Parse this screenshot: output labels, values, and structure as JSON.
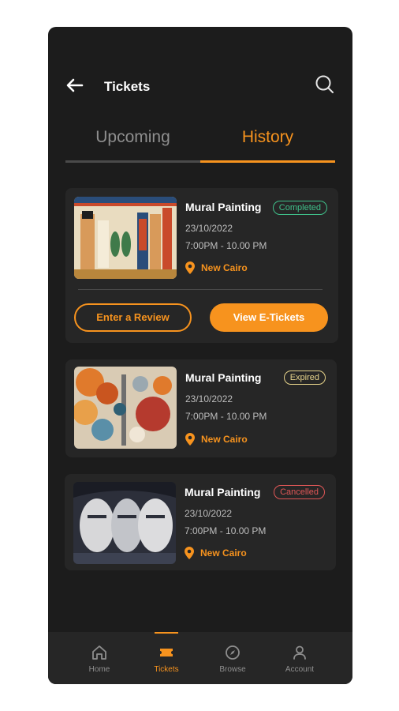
{
  "header": {
    "title": "Tickets"
  },
  "tabs": [
    {
      "label": "Upcoming"
    },
    {
      "label": "History"
    }
  ],
  "cards": [
    {
      "name": "Mural Painting",
      "status": "Completed",
      "date": "23/10/2022",
      "time": "7:00PM - 10.00 PM",
      "location": "New Cairo",
      "review_label": "Enter a Review",
      "tickets_label": "View E-Tickets"
    },
    {
      "name": "Mural Painting",
      "status": "Expired",
      "date": "23/10/2022",
      "time": "7:00PM - 10.00 PM",
      "location": "New Cairo"
    },
    {
      "name": "Mural Painting",
      "status": "Cancelled",
      "date": "23/10/2022",
      "time": "7:00PM - 10.00 PM",
      "location": "New Cairo"
    }
  ],
  "nav": [
    {
      "label": "Home",
      "icon": "home-icon"
    },
    {
      "label": "Tickets",
      "icon": "ticket-icon"
    },
    {
      "label": "Browse",
      "icon": "compass-icon"
    },
    {
      "label": "Account",
      "icon": "user-icon"
    }
  ],
  "colors": {
    "accent": "#f7931e",
    "background": "#1c1c1c",
    "card": "#262626",
    "completed": "#3fc08a",
    "expired": "#e5d28a",
    "cancelled": "#e05757"
  }
}
